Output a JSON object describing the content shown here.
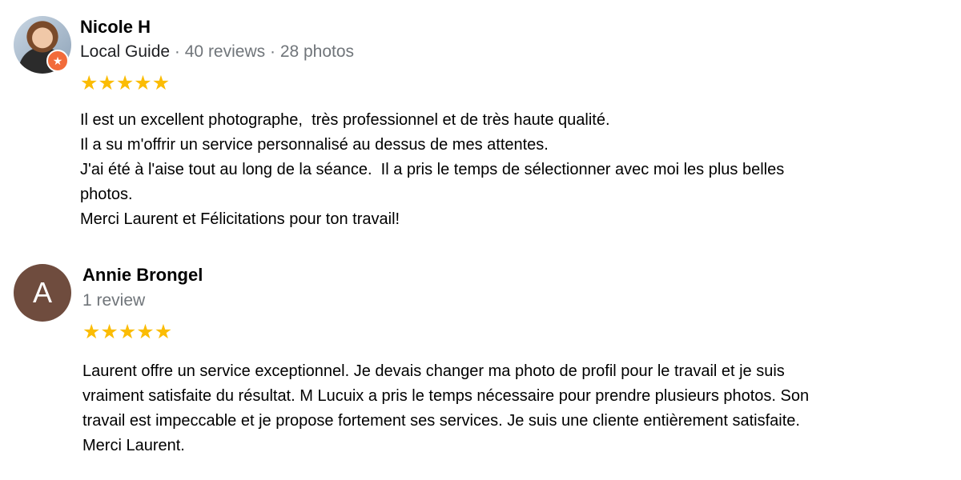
{
  "reviews": [
    {
      "name": "Nicole H",
      "guide_label": "Local Guide",
      "separator": " · ",
      "reviews_count": "40 reviews",
      "photos_count": "28 photos",
      "rating": 5,
      "star_glyph": "★",
      "avatar_icon": "profile-photo",
      "badge_icon": "local-guide-star-icon",
      "text": "Il est un excellent photographe,  très professionnel et de très haute qualité.\nIl a su m'offrir un service personnalisé au dessus de mes attentes.\nJ'ai été à l'aise tout au long de la séance.  Il a pris le temps de sélectionner avec moi les plus belles\nphotos.\nMerci Laurent et Félicitations pour ton travail!"
    },
    {
      "name": "Annie Brongel",
      "avatar_letter": "A",
      "reviews_count": "1 review",
      "rating": 5,
      "star_glyph": "★",
      "text": "Laurent offre un service exceptionnel. Je devais changer ma photo de profil pour le travail et je suis\nvraiment satisfaite du résultat. M Lucuix a pris le temps nécessaire pour prendre plusieurs photos. Son\ntravail est impeccable et je propose fortement ses services. Je suis une cliente entièrement satisfaite.\nMerci Laurent."
    }
  ],
  "colors": {
    "star": "#fbbc04",
    "meta_text": "#70757a",
    "avatar_letter_bg": "#6f4c3e",
    "guide_badge": "#f26b3a"
  }
}
